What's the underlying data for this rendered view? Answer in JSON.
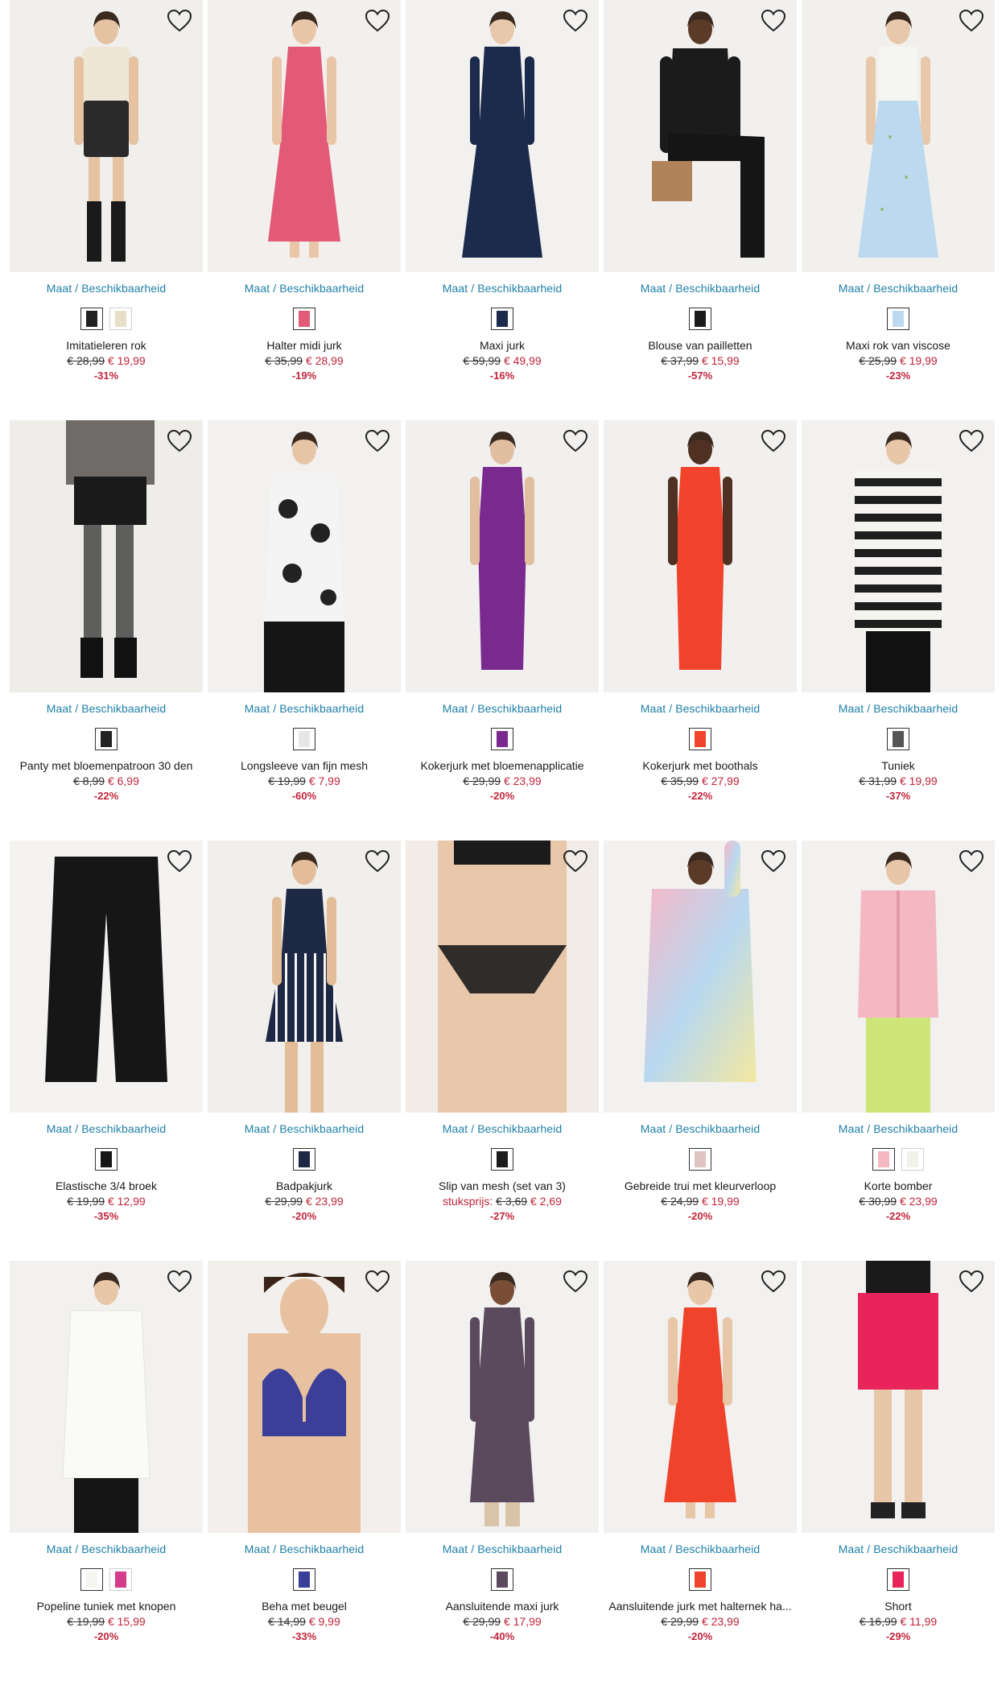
{
  "size_link_label": "Maat / Beschikbaarheid",
  "products": [
    {
      "name": "Imitatieleren rok",
      "old_price": "€ 28,99",
      "new_price": "€ 19,99",
      "discount": "-31%",
      "unit_label": "",
      "bg": "#f1efec",
      "garment": "#2a2a2a",
      "skin": "#e4c2a2",
      "shape": "skirt",
      "swatches": [
        "#222222",
        "#e8dfc9"
      ]
    },
    {
      "name": "Halter midi jurk",
      "old_price": "€ 35,99",
      "new_price": "€ 28,99",
      "discount": "-19%",
      "unit_label": "",
      "bg": "#f3efec",
      "garment": "#e25a78",
      "skin": "#e9c6a8",
      "shape": "dress",
      "swatches": [
        "#e25a78"
      ]
    },
    {
      "name": "Maxi jurk",
      "old_price": "€ 59,99",
      "new_price": "€ 49,99",
      "discount": "-16%",
      "unit_label": "",
      "bg": "#f2f1ef",
      "garment": "#1c2a4c",
      "skin": "#e8c8aa",
      "shape": "gown",
      "swatches": [
        "#1c2a4c"
      ]
    },
    {
      "name": "Blouse van pailletten",
      "old_price": "€ 37,99",
      "new_price": "€ 15,99",
      "discount": "-57%",
      "unit_label": "",
      "bg": "#f2f0ee",
      "garment": "#1b1b1b",
      "skin": "#5c3a28",
      "shape": "seated",
      "swatches": [
        "#1b1b1b"
      ]
    },
    {
      "name": "Maxi rok van viscose",
      "old_price": "€ 25,99",
      "new_price": "€ 19,99",
      "discount": "-23%",
      "unit_label": "",
      "bg": "#f2f0ed",
      "garment": "#bcd9ef",
      "skin": "#e8c8aa",
      "shape": "maxiskirt",
      "swatches": [
        "#bcd9ef"
      ]
    },
    {
      "name": "Panty met bloemenpatroon 30 den",
      "old_price": "€ 8,99",
      "new_price": "€ 6,99",
      "discount": "-22%",
      "unit_label": "",
      "bg": "#efedea",
      "garment": "#222222",
      "skin": "#3a3a3a",
      "shape": "legs",
      "swatches": [
        "#222222"
      ]
    },
    {
      "name": "Longsleeve van fijn mesh",
      "old_price": "€ 19,99",
      "new_price": "€ 7,99",
      "discount": "-60%",
      "unit_label": "",
      "bg": "#f2f1ef",
      "garment": "#f4f4f4",
      "skin": "#e6c4a6",
      "shape": "top",
      "swatches": [
        "#e6e6e6"
      ]
    },
    {
      "name": "Kokerjurk met bloemenapplicatie",
      "old_price": "€ 29,99",
      "new_price": "€ 23,99",
      "discount": "-20%",
      "unit_label": "",
      "bg": "#f2f0ee",
      "garment": "#7a2a8e",
      "skin": "#e2bea0",
      "shape": "sheath",
      "swatches": [
        "#7a2a8e"
      ]
    },
    {
      "name": "Kokerjurk met boothals",
      "old_price": "€ 35,99",
      "new_price": "€ 27,99",
      "discount": "-22%",
      "unit_label": "",
      "bg": "#f2f0ee",
      "garment": "#f2432c",
      "skin": "#4f3022",
      "shape": "sheath",
      "swatches": [
        "#f2432c"
      ]
    },
    {
      "name": "Tuniek",
      "old_price": "€ 31,99",
      "new_price": "€ 19,99",
      "discount": "-37%",
      "unit_label": "",
      "bg": "#f2f1ef",
      "garment": "#1e1e1e",
      "skin": "#e8c6a8",
      "shape": "stripes",
      "swatches": [
        "#555555"
      ]
    },
    {
      "name": "Elastische 3/4 broek",
      "old_price": "€ 19,99",
      "new_price": "€ 12,99",
      "discount": "-35%",
      "unit_label": "",
      "bg": "#f4f3f1",
      "garment": "#161616",
      "skin": "#f4f3f1",
      "shape": "pants",
      "swatches": [
        "#161616"
      ]
    },
    {
      "name": "Badpakjurk",
      "old_price": "€ 29,99",
      "new_price": "€ 23,99",
      "discount": "-20%",
      "unit_label": "",
      "bg": "#f1efec",
      "garment": "#1d2844",
      "skin": "#e3bc98",
      "shape": "swimdress",
      "swatches": [
        "#1d2844"
      ]
    },
    {
      "name": "Slip van mesh (set van 3)",
      "old_price": "€ 3,69",
      "new_price": "€ 2,69",
      "discount": "-27%",
      "unit_label": "stuksprijs:",
      "bg": "#f1ece8",
      "garment": "#1b1b1b",
      "skin": "#e9c7ab",
      "shape": "brief",
      "swatches": [
        "#1b1b1b"
      ]
    },
    {
      "name": "Gebreide trui met kleurverloop",
      "old_price": "€ 24,99",
      "new_price": "€ 19,99",
      "discount": "-20%",
      "unit_label": "",
      "bg": "#f2f1ef",
      "garment": "#c8a8e0",
      "skin": "#5c3a28",
      "shape": "sweater",
      "swatches": [
        "#e0c4c4"
      ]
    },
    {
      "name": "Korte bomber",
      "old_price": "€ 30,99",
      "new_price": "€ 23,99",
      "discount": "-22%",
      "unit_label": "",
      "bg": "#f2f1ef",
      "garment": "#f4b8c2",
      "skin": "#e8c6a8",
      "shape": "bomber",
      "swatches": [
        "#f4b8c2",
        "#f2f1ea"
      ]
    },
    {
      "name": "Popeline tuniek met knopen",
      "old_price": "€ 19,99",
      "new_price": "€ 15,99",
      "discount": "-20%",
      "unit_label": "",
      "bg": "#f2f1ef",
      "garment": "#fafaf8",
      "skin": "#e8c6a8",
      "shape": "tunic",
      "swatches": [
        "#f5f5f2",
        "#d63c8c"
      ]
    },
    {
      "name": "Beha met beugel",
      "old_price": "€ 14,99",
      "new_price": "€ 9,99",
      "discount": "-33%",
      "unit_label": "",
      "bg": "#f2efec",
      "garment": "#3c3f9a",
      "skin": "#e8c2a0",
      "shape": "bra",
      "swatches": [
        "#3c3f9a"
      ]
    },
    {
      "name": "Aansluitende maxi jurk",
      "old_price": "€ 29,99",
      "new_price": "€ 17,99",
      "discount": "-40%",
      "unit_label": "",
      "bg": "#f2f1ef",
      "garment": "#5b4a5e",
      "skin": "#7a4e36",
      "shape": "maxidress",
      "swatches": [
        "#5b4a5e"
      ]
    },
    {
      "name": "Aansluitende jurk met halternek ha...",
      "old_price": "€ 29,99",
      "new_price": "€ 23,99",
      "discount": "-20%",
      "unit_label": "",
      "bg": "#f2f1ef",
      "garment": "#f0432c",
      "skin": "#e8c6a8",
      "shape": "dress",
      "swatches": [
        "#f0432c"
      ]
    },
    {
      "name": "Short",
      "old_price": "€ 16,99",
      "new_price": "€ 11,99",
      "discount": "-29%",
      "unit_label": "",
      "bg": "#f2f1ef",
      "garment": "#e9245a",
      "skin": "#e8c6a8",
      "shape": "shorts",
      "swatches": [
        "#e9245a"
      ]
    }
  ]
}
